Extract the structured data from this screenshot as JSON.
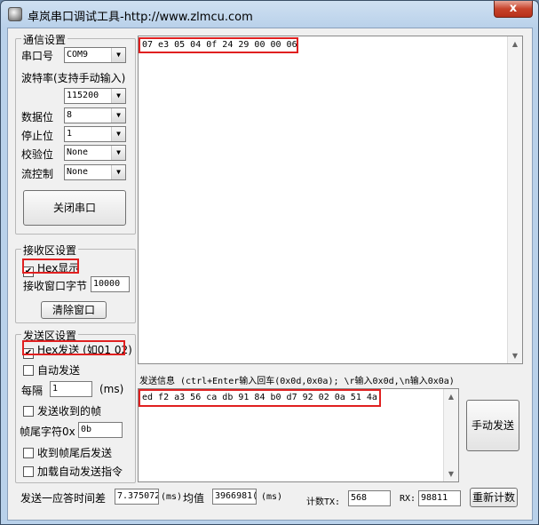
{
  "window": {
    "title": "卓岚串口调试工具-http://www.zlmcu.com",
    "close_glyph": "x"
  },
  "comm": {
    "title": "通信设置",
    "port_label": "串口号",
    "port_value": "COM9",
    "baud_label": "波特率(支持手动输入)",
    "baud_value": "115200",
    "data_label": "数据位",
    "data_value": "8",
    "stop_label": "停止位",
    "stop_value": "1",
    "parity_label": "校验位",
    "parity_value": "None",
    "flow_label": "流控制",
    "flow_value": "None",
    "close_port": "关闭串口"
  },
  "recv": {
    "title": "接收区设置",
    "hex_display": "Hex显示",
    "hex_checked": "✔",
    "bytes_label": "接收窗口字节",
    "bytes_value": "10000",
    "clear": "清除窗口"
  },
  "send": {
    "title": "发送区设置",
    "hex_send": "Hex发送 (如01 02)",
    "hex_checked": "✔",
    "auto_send": "自动发送",
    "interval_label": "每隔",
    "interval_value": "1",
    "interval_unit": "(ms)",
    "send_on_recv": "发送收到的帧",
    "tail_label": "帧尾字符0x",
    "tail_value": "0b",
    "send_after_tail": "收到帧尾后发送",
    "load_auto": "加载自动发送指令"
  },
  "receive_area": {
    "text": "07 e3 05 04 0f 24 29 00 00 06"
  },
  "send_info": {
    "label": "发送信息 (ctrl+Enter输入回车(0x0d,0x0a); \\r输入0x0d,\\n输入0x0a)"
  },
  "send_area": {
    "text": "ed f2 a3 56 ca db 91 84 b0 d7 92 02 0a 51 4a"
  },
  "manual_send": "手动发送",
  "status": {
    "resp_label": "发送一应答时间差",
    "resp_value": "7.375072",
    "unit1": "(ms)",
    "avg_label": "均值",
    "avg_value": "3966981(",
    "unit2": "(ms)",
    "tx_label": "计数TX:",
    "tx_value": "568",
    "rx_label": "RX:",
    "rx_value": "98811",
    "reset": "重新计数"
  }
}
